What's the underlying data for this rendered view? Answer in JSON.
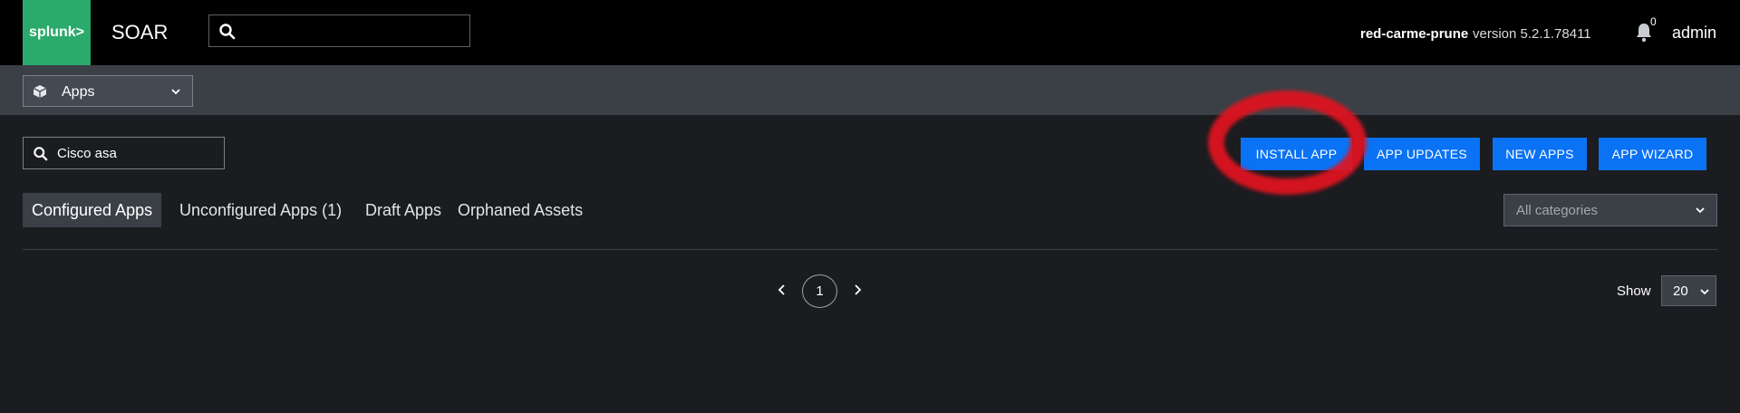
{
  "header": {
    "logo_text": "splunk>",
    "app_name": "SOAR",
    "search_placeholder": "",
    "server_name": "red-carme-prune",
    "version": "version 5.2.1.78411",
    "notification_count": "0",
    "user": "admin"
  },
  "subbar": {
    "section": "Apps"
  },
  "toolbar": {
    "search_value": "Cisco asa",
    "buttons": [
      "INSTALL APP",
      "APP UPDATES",
      "NEW APPS",
      "APP WIZARD"
    ]
  },
  "tabs": [
    {
      "label": "Configured Apps",
      "active": true
    },
    {
      "label": "Unconfigured Apps (1)",
      "active": false
    },
    {
      "label": "Draft Apps",
      "active": false
    },
    {
      "label": "Orphaned Assets",
      "active": false
    }
  ],
  "category_filter": {
    "placeholder": "All categories"
  },
  "pagination": {
    "current_page": "1",
    "show_label": "Show",
    "page_size": "20"
  },
  "colors": {
    "brand_green": "#2bab6b",
    "button_blue": "#0a72f5",
    "annotation_red": "#e3131f"
  },
  "icons": [
    "search-icon",
    "cube-icon",
    "chevron-down-icon",
    "bell-icon",
    "chevron-left-icon",
    "chevron-right-icon"
  ]
}
